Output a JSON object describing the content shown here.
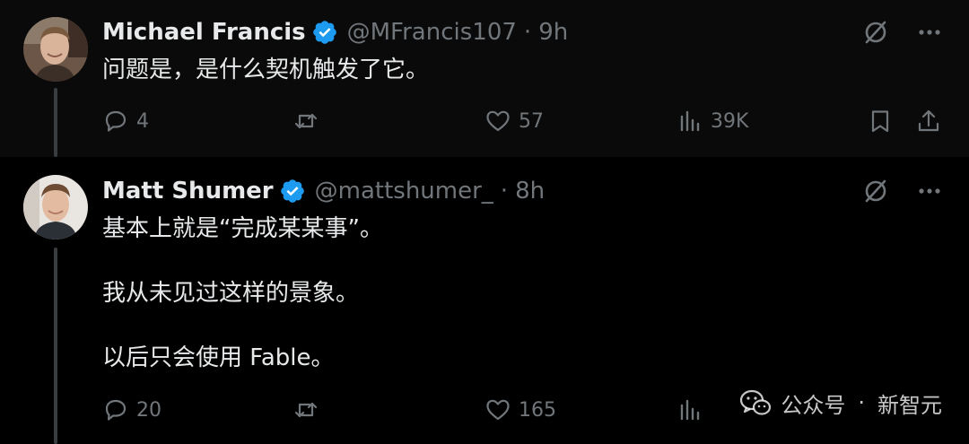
{
  "tweets": [
    {
      "author_name": "Michael Francis",
      "author_handle": "@MFrancis107",
      "separator": "·",
      "time": "9h",
      "paragraphs": [
        "问题是，是什么契机触发了它。"
      ],
      "replies": "4",
      "retweets": "",
      "likes": "57",
      "views": "39K"
    },
    {
      "author_name": "Matt Shumer",
      "author_handle": "@mattshumer_",
      "separator": "·",
      "time": "8h",
      "paragraphs": [
        "基本上就是“完成某某事”。",
        "我从未见过这样的景象。",
        "以后只会使用 Fable。"
      ],
      "replies": "20",
      "retweets": "",
      "likes": "165",
      "views": ""
    }
  ],
  "watermark": {
    "label": "公众号",
    "separator": "·",
    "account": "新智元"
  },
  "icons": {
    "verified": "verified-badge-icon",
    "grok": "grok-icon",
    "more": "more-icon",
    "reply": "reply-icon",
    "retweet": "retweet-icon",
    "like": "heart-icon",
    "views": "views-chart-icon",
    "bookmark": "bookmark-icon",
    "share": "share-icon",
    "wechat": "wechat-icon"
  },
  "colors": {
    "background": "#000000",
    "text": "#e7e9ea",
    "muted": "#71767b",
    "verified": "#1d9bf0"
  }
}
